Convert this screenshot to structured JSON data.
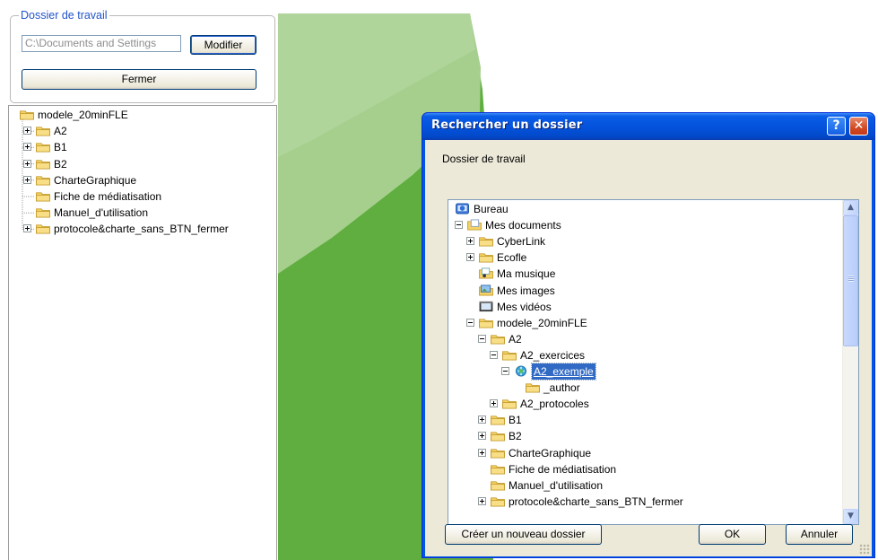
{
  "left_panel": {
    "group_title": "Dossier de travail",
    "path_value": "C:\\Documents and Settings",
    "modify_label": "Modifier",
    "close_label": "Fermer",
    "tree": [
      {
        "label": "modele_20minFLE",
        "level": 0,
        "expander": "none"
      },
      {
        "label": "A2",
        "level": 1,
        "expander": "plus"
      },
      {
        "label": "B1",
        "level": 1,
        "expander": "plus"
      },
      {
        "label": "B2",
        "level": 1,
        "expander": "plus"
      },
      {
        "label": "CharteGraphique",
        "level": 1,
        "expander": "plus"
      },
      {
        "label": "Fiche de médiatisation",
        "level": 1,
        "expander": "none"
      },
      {
        "label": "Manuel_d'utilisation",
        "level": 1,
        "expander": "none"
      },
      {
        "label": "protocole&charte_sans_BTN_fermer",
        "level": 1,
        "expander": "plus"
      }
    ]
  },
  "dialog": {
    "title": "Rechercher un dossier",
    "help_glyph": "?",
    "close_glyph": "✕",
    "description": "Dossier de travail",
    "tree": [
      {
        "label": "Bureau",
        "level": 0,
        "expander": "none",
        "icon": "desktop-icon"
      },
      {
        "label": "Mes documents",
        "level": 1,
        "expander": "minus",
        "icon": "my-documents-icon"
      },
      {
        "label": "CyberLink",
        "level": 2,
        "expander": "plus",
        "icon": "folder-icon"
      },
      {
        "label": "Ecofle",
        "level": 2,
        "expander": "plus",
        "icon": "folder-icon"
      },
      {
        "label": "Ma musique",
        "level": 2,
        "expander": "none",
        "icon": "music-folder-icon"
      },
      {
        "label": "Mes images",
        "level": 2,
        "expander": "none",
        "icon": "pictures-folder-icon"
      },
      {
        "label": "Mes vidéos",
        "level": 2,
        "expander": "none",
        "icon": "videos-folder-icon"
      },
      {
        "label": "modele_20minFLE",
        "level": 2,
        "expander": "minus",
        "icon": "folder-icon"
      },
      {
        "label": "A2",
        "level": 3,
        "expander": "minus",
        "icon": "folder-icon"
      },
      {
        "label": "A2_exercices",
        "level": 4,
        "expander": "minus",
        "icon": "folder-icon"
      },
      {
        "label": "A2_exemple",
        "level": 5,
        "expander": "minus",
        "icon": "web-folder-icon",
        "selected": true
      },
      {
        "label": "_author",
        "level": 6,
        "expander": "none",
        "icon": "folder-icon"
      },
      {
        "label": "A2_protocoles",
        "level": 4,
        "expander": "plus",
        "icon": "folder-icon"
      },
      {
        "label": "B1",
        "level": 3,
        "expander": "plus",
        "icon": "folder-icon"
      },
      {
        "label": "B2",
        "level": 3,
        "expander": "plus",
        "icon": "folder-icon"
      },
      {
        "label": "CharteGraphique",
        "level": 3,
        "expander": "plus",
        "icon": "folder-icon"
      },
      {
        "label": "Fiche de médiatisation",
        "level": 3,
        "expander": "none",
        "icon": "folder-icon"
      },
      {
        "label": "Manuel_d'utilisation",
        "level": 3,
        "expander": "none",
        "icon": "folder-icon"
      },
      {
        "label": "protocole&charte_sans_BTN_fermer",
        "level": 3,
        "expander": "plus",
        "icon": "folder-icon"
      }
    ],
    "new_folder_label": "Créer un nouveau dossier",
    "ok_label": "OK",
    "cancel_label": "Annuler"
  },
  "colors": {
    "accent": "#0055e5",
    "selection": "#316ac5",
    "folder": "#f5d266",
    "green_dark": "#5fae3f",
    "green_light": "#a6cf8e"
  }
}
